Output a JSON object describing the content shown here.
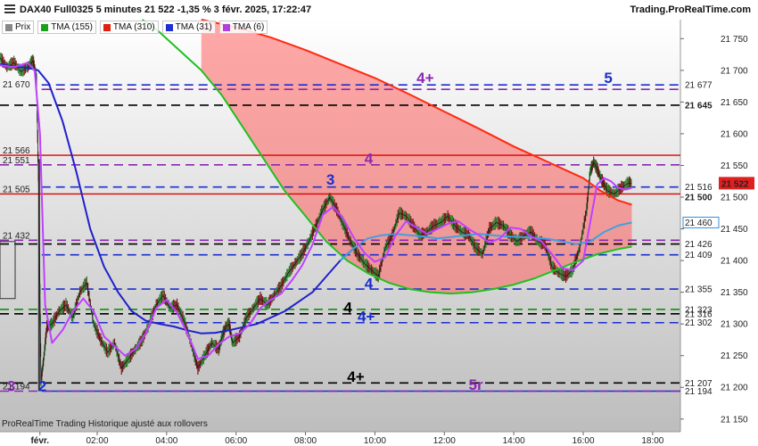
{
  "header": {
    "title": "DAX40 Full0325 5 minutes 21 522 -1,35 % 3 févr. 2025, 17:22:47",
    "brand": "Trading.ProRealTime.com"
  },
  "legend": [
    {
      "label": "Prix",
      "color": "#888888"
    },
    {
      "label": "TMA (155)",
      "color": "#1aa01a"
    },
    {
      "label": "TMA (310)",
      "color": "#e02010"
    },
    {
      "label": "TMA (31)",
      "color": "#2030d0"
    },
    {
      "label": "TMA (6)",
      "color": "#b040e0"
    }
  ],
  "footer": {
    "note": "ProRealTime Trading  Historique ajusté aux rollovers"
  },
  "colors": {
    "price": "#1a3a1a",
    "up": "#2a7a2a",
    "down": "#7a1a1a",
    "tma155": "#20c020",
    "tma310": "#ff2a10",
    "tma31": "#2020cc",
    "tma31b": "#40a0e0",
    "tma6": "#c040ff",
    "fill": "#ff6060",
    "purple": "#8a28b0",
    "blue": "#1b2ed0",
    "red": "#e00000",
    "black": "#000000",
    "green": "#109010",
    "gray": "#c8c8c8"
  },
  "chart_data": {
    "type": "line",
    "ylim": [
      21130,
      21780
    ],
    "y_ticks": [
      21150,
      21200,
      21250,
      21300,
      21350,
      21400,
      21450,
      21500,
      21550,
      21600,
      21650,
      21700,
      21750
    ],
    "y_tick_labels": [
      "21 150",
      "21 200",
      "21 250",
      "21 300",
      "21 350",
      "21 400",
      "21 450",
      "21 500",
      "21 550",
      "21 600",
      "21 650",
      "21 700",
      "21 750"
    ],
    "x_ticks": [
      {
        "label": "févr.",
        "h": 0.35
      },
      {
        "label": "02:00",
        "h": 2.0
      },
      {
        "label": "04:00",
        "h": 4.0
      },
      {
        "label": "06:00",
        "h": 6.0
      },
      {
        "label": "08:00",
        "h": 8.0
      },
      {
        "label": "10:00",
        "h": 10.0
      },
      {
        "label": "12:00",
        "h": 12.0
      },
      {
        "label": "14:00",
        "h": 14.0
      },
      {
        "label": "16:00",
        "h": 16.0
      },
      {
        "label": "18:00",
        "h": 18.0
      }
    ],
    "xlim_hours": [
      -0.8,
      18.8
    ],
    "last_price": {
      "value": 21522,
      "label": "21 522"
    },
    "right_labels": [
      {
        "value": 21677,
        "label": "21 677",
        "color": "#1b2ed0"
      },
      {
        "value": 21645,
        "label": "21 645",
        "color": "#000000",
        "bold": true
      },
      {
        "value": 21516,
        "label": "21 516",
        "color": "#1b2ed0"
      },
      {
        "value": 21500,
        "label": "21 500",
        "color": "#000000",
        "bold": true
      },
      {
        "value": 21460,
        "label": "21 460",
        "color": "#3090e0",
        "box": true
      },
      {
        "value": 21426,
        "label": "21 426",
        "color": "#000000"
      },
      {
        "value": 21409,
        "label": "21 409",
        "color": "#1b2ed0"
      },
      {
        "value": 21355,
        "label": "21 355",
        "color": "#1b2ed0"
      },
      {
        "value": 21323,
        "label": "21 323",
        "color": "#109010"
      },
      {
        "value": 21316,
        "label": "21 316",
        "color": "#000000"
      },
      {
        "value": 21302,
        "label": "21 302",
        "color": "#1b2ed0"
      },
      {
        "value": 21207,
        "label": "21 207",
        "color": "#000000"
      },
      {
        "value": 21194,
        "label": "21 194",
        "color": "#1b2ed0"
      }
    ],
    "left_labels": [
      {
        "value": 21670,
        "label": "21 670",
        "color": "#8a28b0"
      },
      {
        "value": 21566,
        "label": "21 566",
        "color": "#e00000"
      },
      {
        "value": 21551,
        "label": "21 551",
        "color": "#8a28b0"
      },
      {
        "value": 21505,
        "label": "21 505",
        "color": "#e00000"
      },
      {
        "value": 21432,
        "label": "21 432",
        "color": "#8a28b0"
      },
      {
        "value": 21194,
        "label": "21 194",
        "color": "#8a28b0"
      }
    ],
    "hlines": [
      {
        "value": 21677,
        "color": "#1b2ed0",
        "dash": true,
        "from_h": 0.4
      },
      {
        "value": 21670,
        "color": "#8a28b0",
        "dash": true,
        "from_h": 0.4
      },
      {
        "value": 21645,
        "color": "#000000",
        "dash": true,
        "from_h": -0.8
      },
      {
        "value": 21566,
        "color": "#e00000",
        "dash": false,
        "from_h": -0.8
      },
      {
        "value": 21551,
        "color": "#8a28b0",
        "dash": true,
        "from_h": -0.8
      },
      {
        "value": 21516,
        "color": "#1b2ed0",
        "dash": true,
        "from_h": 0.4
      },
      {
        "value": 21505,
        "color": "#e00000",
        "dash": false,
        "from_h": -0.8
      },
      {
        "value": 21432,
        "color": "#8a28b0",
        "dash": true,
        "from_h": -0.8
      },
      {
        "value": 21426,
        "color": "#000000",
        "dash": true,
        "from_h": -0.8
      },
      {
        "value": 21409,
        "color": "#1b2ed0",
        "dash": true,
        "from_h": 0.4
      },
      {
        "value": 21355,
        "color": "#1b2ed0",
        "dash": true,
        "from_h": 0.4
      },
      {
        "value": 21323,
        "color": "#109010",
        "dash": true,
        "from_h": -0.8
      },
      {
        "value": 21316,
        "color": "#000000",
        "dash": true,
        "from_h": -0.8
      },
      {
        "value": 21302,
        "color": "#1b2ed0",
        "dash": true,
        "from_h": 0.4
      },
      {
        "value": 21207,
        "color": "#000000",
        "dash": true,
        "from_h": -0.8
      },
      {
        "value": 21194,
        "color": "#1b2ed0",
        "dash": false,
        "from_h": 0.4
      },
      {
        "value": 21194,
        "color": "#8a28b0",
        "dash": true,
        "from_h": -0.8
      }
    ],
    "annotations": [
      {
        "text": "4+",
        "h": 11.2,
        "value": 21680,
        "color": "#8a28b0"
      },
      {
        "text": "5",
        "h": 16.6,
        "value": 21680,
        "color": "#1b2ed0"
      },
      {
        "text": "4",
        "h": 9.7,
        "value": 21553,
        "color": "#8a28b0"
      },
      {
        "text": "3",
        "h": 8.6,
        "value": 21520,
        "color": "#1b2ed0"
      },
      {
        "text": "4",
        "h": 9.7,
        "value": 21356,
        "color": "#1b2ed0"
      },
      {
        "text": "4",
        "h": 9.1,
        "value": 21318,
        "color": "#000000"
      },
      {
        "text": "4+",
        "h": 9.5,
        "value": 21304,
        "color": "#1b2ed0"
      },
      {
        "text": "4+",
        "h": 9.2,
        "value": 21209,
        "color": "#000000"
      },
      {
        "text": "5r",
        "h": 12.7,
        "value": 21196,
        "color": "#8a28b0"
      },
      {
        "text": "3",
        "h": -0.6,
        "value": 21194,
        "color": "#8a28b0"
      },
      {
        "text": "2",
        "h": 0.3,
        "value": 21194,
        "color": "#1b2ed0"
      }
    ],
    "price": {
      "x": [
        -0.8,
        -0.6,
        -0.4,
        -0.2,
        0.0,
        0.15,
        0.25,
        0.32,
        0.38,
        0.45,
        0.55,
        0.7,
        0.9,
        1.1,
        1.3,
        1.5,
        1.7,
        1.9,
        2.1,
        2.3,
        2.5,
        2.7,
        2.9,
        3.1,
        3.3,
        3.5,
        3.7,
        3.9,
        4.1,
        4.3,
        4.5,
        4.7,
        4.9,
        5.1,
        5.3,
        5.5,
        5.6,
        5.7,
        5.8,
        5.9,
        6.1,
        6.3,
        6.5,
        6.7,
        6.9,
        7.1,
        7.3,
        7.5,
        7.7,
        7.9,
        8.1,
        8.3,
        8.5,
        8.7,
        8.9,
        9.1,
        9.3,
        9.5,
        9.7,
        9.9,
        10.1,
        10.3,
        10.5,
        10.7,
        10.9,
        11.1,
        11.3,
        11.5,
        11.7,
        11.9,
        12.1,
        12.3,
        12.5,
        12.7,
        12.9,
        13.1,
        13.3,
        13.5,
        13.7,
        13.9,
        14.1,
        14.3,
        14.5,
        14.7,
        14.9,
        15.1,
        15.3,
        15.5,
        15.7,
        15.9,
        16.1,
        16.2,
        16.3,
        16.4,
        16.5,
        16.6,
        16.7,
        16.9,
        17.1,
        17.3,
        17.4
      ],
      "y": [
        21720,
        21705,
        21712,
        21698,
        21705,
        21715,
        21690,
        21500,
        21210,
        21240,
        21295,
        21300,
        21320,
        21330,
        21310,
        21350,
        21365,
        21300,
        21275,
        21255,
        21270,
        21230,
        21245,
        21260,
        21275,
        21300,
        21330,
        21345,
        21325,
        21330,
        21305,
        21270,
        21230,
        21250,
        21270,
        21260,
        21280,
        21295,
        21300,
        21270,
        21280,
        21310,
        21325,
        21340,
        21330,
        21345,
        21360,
        21380,
        21395,
        21410,
        21430,
        21455,
        21480,
        21500,
        21480,
        21455,
        21430,
        21410,
        21395,
        21385,
        21375,
        21420,
        21440,
        21475,
        21470,
        21455,
        21440,
        21445,
        21455,
        21460,
        21470,
        21455,
        21445,
        21440,
        21420,
        21410,
        21450,
        21460,
        21455,
        21440,
        21430,
        21440,
        21445,
        21430,
        21425,
        21390,
        21380,
        21375,
        21385,
        21420,
        21480,
        21540,
        21555,
        21545,
        21530,
        21520,
        21510,
        21505,
        21515,
        21522,
        21522
      ]
    },
    "tma6": {
      "x": [
        -0.8,
        -0.4,
        0.0,
        0.2,
        0.35,
        0.5,
        0.7,
        1.0,
        1.3,
        1.6,
        1.9,
        2.2,
        2.5,
        2.8,
        3.1,
        3.4,
        3.7,
        4.0,
        4.3,
        4.6,
        4.9,
        5.2,
        5.5,
        5.8,
        6.1,
        6.4,
        6.7,
        7.0,
        7.3,
        7.6,
        7.9,
        8.2,
        8.5,
        8.8,
        9.1,
        9.4,
        9.7,
        10.0,
        10.3,
        10.6,
        10.9,
        11.2,
        11.5,
        11.8,
        12.1,
        12.4,
        12.7,
        13.0,
        13.3,
        13.6,
        13.9,
        14.2,
        14.5,
        14.8,
        15.1,
        15.4,
        15.7,
        16.0,
        16.2,
        16.4,
        16.6,
        16.8,
        17.0,
        17.2,
        17.4
      ],
      "y": [
        21708,
        21705,
        21712,
        21700,
        21600,
        21330,
        21270,
        21290,
        21320,
        21340,
        21320,
        21280,
        21265,
        21250,
        21260,
        21285,
        21325,
        21338,
        21318,
        21285,
        21245,
        21250,
        21268,
        21280,
        21285,
        21300,
        21325,
        21338,
        21348,
        21368,
        21392,
        21425,
        21472,
        21485,
        21465,
        21435,
        21412,
        21398,
        21405,
        21440,
        21462,
        21452,
        21442,
        21450,
        21458,
        21462,
        21450,
        21440,
        21428,
        21435,
        21452,
        21450,
        21438,
        21430,
        21410,
        21388,
        21385,
        21400,
        21460,
        21520,
        21530,
        21525,
        21515,
        21512,
        21515
      ]
    },
    "tma31": {
      "x": [
        -0.8,
        -0.4,
        0.0,
        0.3,
        0.6,
        1.0,
        1.4,
        1.8,
        2.2,
        2.6,
        3.0,
        3.4,
        3.8,
        4.2,
        4.6,
        5.0,
        5.4,
        5.8,
        6.2,
        6.6,
        7.0,
        7.4,
        7.8,
        8.2,
        8.6,
        9.0,
        9.4,
        9.8,
        10.2,
        10.6,
        11.0,
        11.4,
        11.8,
        12.2,
        12.6,
        13.0,
        13.4,
        13.8,
        14.2,
        14.6,
        15.0,
        15.4,
        15.8,
        16.2,
        16.6,
        17.0,
        17.4
      ],
      "y": [
        21710,
        21706,
        21704,
        21700,
        21680,
        21620,
        21540,
        21450,
        21390,
        21350,
        21320,
        21305,
        21300,
        21296,
        21290,
        21285,
        21286,
        21290,
        21295,
        21300,
        21310,
        21320,
        21335,
        21350,
        21375,
        21400,
        21420,
        21435,
        21440,
        21442,
        21440,
        21438,
        21435,
        21437,
        21440,
        21442,
        21440,
        21438,
        21437,
        21436,
        21434,
        21430,
        21426,
        21430,
        21445,
        21455,
        21460
      ]
    },
    "tma155": {
      "x": [
        3.3,
        3.8,
        4.4,
        5.0,
        5.6,
        6.2,
        6.8,
        7.4,
        8.0,
        8.6,
        9.2,
        9.8,
        10.4,
        11.0,
        11.6,
        12.2,
        12.8,
        13.4,
        14.0,
        14.6,
        15.2,
        15.8,
        16.4,
        17.0,
        17.4
      ],
      "y": [
        21780,
        21760,
        21730,
        21700,
        21660,
        21610,
        21560,
        21510,
        21470,
        21430,
        21400,
        21380,
        21365,
        21355,
        21350,
        21348,
        21350,
        21355,
        21362,
        21372,
        21385,
        21398,
        21410,
        21418,
        21422
      ]
    },
    "tma310": {
      "x": [
        5.0,
        6.0,
        7.0,
        8.0,
        9.0,
        10.0,
        11.0,
        12.0,
        13.0,
        14.0,
        15.0,
        16.0,
        16.5,
        17.0,
        17.4
      ],
      "y": [
        21780,
        21768,
        21752,
        21732,
        21710,
        21688,
        21662,
        21635,
        21608,
        21580,
        21555,
        21530,
        21510,
        21495,
        21488
      ]
    }
  }
}
